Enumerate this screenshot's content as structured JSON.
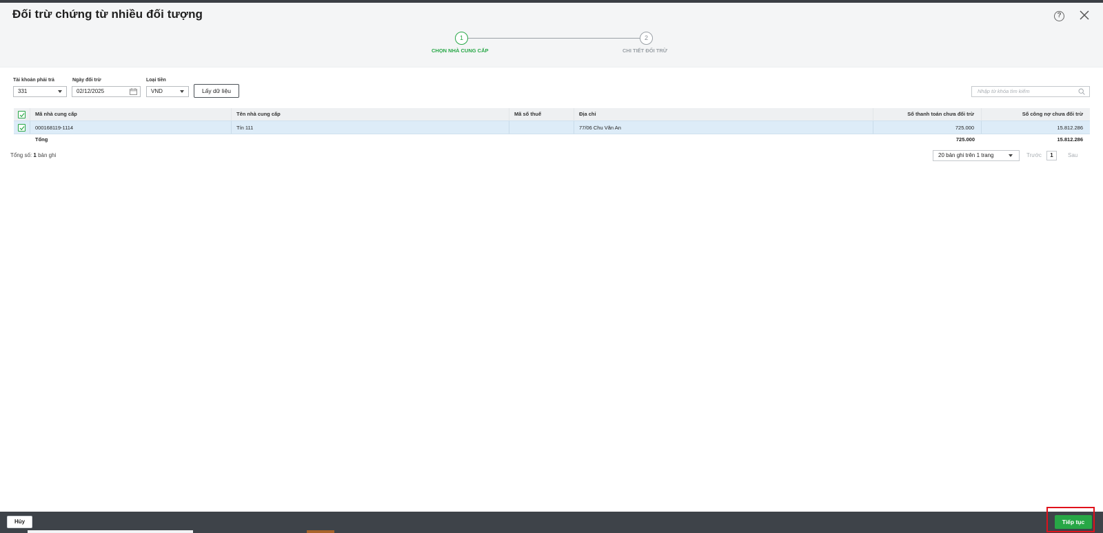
{
  "window": {
    "title": "Đối trừ chứng từ nhiều đối tượng"
  },
  "stepper": {
    "step1": {
      "number": "1",
      "label": "CHỌN NHÀ CUNG CẤP"
    },
    "step2": {
      "number": "2",
      "label": "CHI TIẾT ĐỐI TRỪ"
    }
  },
  "filters": {
    "account": {
      "label": "Tài khoản phải trả",
      "value": "331"
    },
    "date": {
      "label": "Ngày đối trừ",
      "value": "02/12/2025"
    },
    "currency": {
      "label": "Loại tiền",
      "value": "VND"
    },
    "fetch_label": "Lấy dữ liệu",
    "search_placeholder": "Nhập từ khóa tìm kiếm"
  },
  "grid": {
    "columns": [
      "Mã nhà cung cấp",
      "Tên nhà cung cấp",
      "Mã số thuế",
      "Địa chỉ",
      "Số thanh toán chưa đối trừ",
      "Số công nợ chưa đối trừ"
    ],
    "rows": [
      {
        "checked": true,
        "code": "000168119-1114",
        "name": "Tín 111",
        "tax_code": "",
        "address": "77/06 Chu Văn An",
        "unpaid_payment": "725.000",
        "unpaid_debt": "15.812.286"
      }
    ],
    "total": {
      "label": "Tổng",
      "unpaid_payment": "725.000",
      "unpaid_debt": "15.812.286"
    }
  },
  "pager": {
    "count_prefix": "Tổng số:",
    "count_value": "1",
    "count_suffix": "bản ghi",
    "page_size": "20 bản ghi trên 1 trang",
    "prev_label": "Trước",
    "current_page": "1",
    "next_label": "Sau"
  },
  "footer": {
    "cancel_label": "Hủy",
    "next_label": "Tiếp tục"
  },
  "colors": {
    "accent_green": "#27a746",
    "selected_row": "#ddecf8",
    "footer_bar": "#3e4349",
    "highlight": "#e0111b"
  },
  "icons": {
    "help": "help-circle-icon",
    "close": "close-icon",
    "calendar": "calendar-icon",
    "search": "search-icon",
    "dropdown": "chevron-down-icon",
    "checkbox": "checkbox-checked-icon"
  }
}
